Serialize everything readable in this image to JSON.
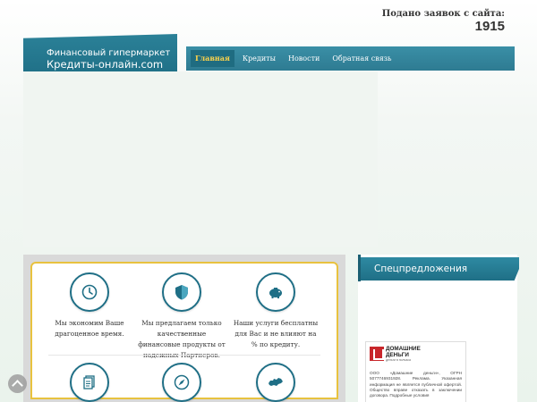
{
  "counter": {
    "label": "Подано заявок с сайта:",
    "value": "1915"
  },
  "logo": {
    "line1": "Финансовый гипермаркет",
    "line2": "Кредиты-онлайн.com"
  },
  "nav": [
    {
      "label": "Главная",
      "active": true
    },
    {
      "label": "Кредиты",
      "active": false
    },
    {
      "label": "Новости",
      "active": false
    },
    {
      "label": "Обратная связь",
      "active": false
    }
  ],
  "features": [
    {
      "icon": "clock-icon",
      "text": "Мы экономим Ваше драгоценное время."
    },
    {
      "icon": "shield-icon",
      "text": "Мы предлагаем только качественные финансовые продукты от надежных Партнеров."
    },
    {
      "icon": "piggy-bank-icon",
      "text": "Наши услуги бесплатны для Вас и не влияют на % по кредиту."
    },
    {
      "icon": "document-icon",
      "text": ""
    },
    {
      "icon": "compass-icon",
      "text": ""
    },
    {
      "icon": "map-russia-icon",
      "text": ""
    }
  ],
  "sidebar": {
    "title": "Спецпредложения",
    "ad": {
      "brand_line1": "ДОМАШНИЕ",
      "brand_line2": "ДЕНЬГИ",
      "brand_sub": "деньги в полчаса",
      "text": "ООО «Домашние деньги», ОГРН 5077746931928. Реклама. Указанная информация не является публичной офертой. Общество вправе отказать в заключении договора. Подробные условия"
    }
  },
  "colors": {
    "primary": "#1f6f86",
    "accent": "#e8c23f",
    "active_nav_text": "#ffd34a"
  }
}
